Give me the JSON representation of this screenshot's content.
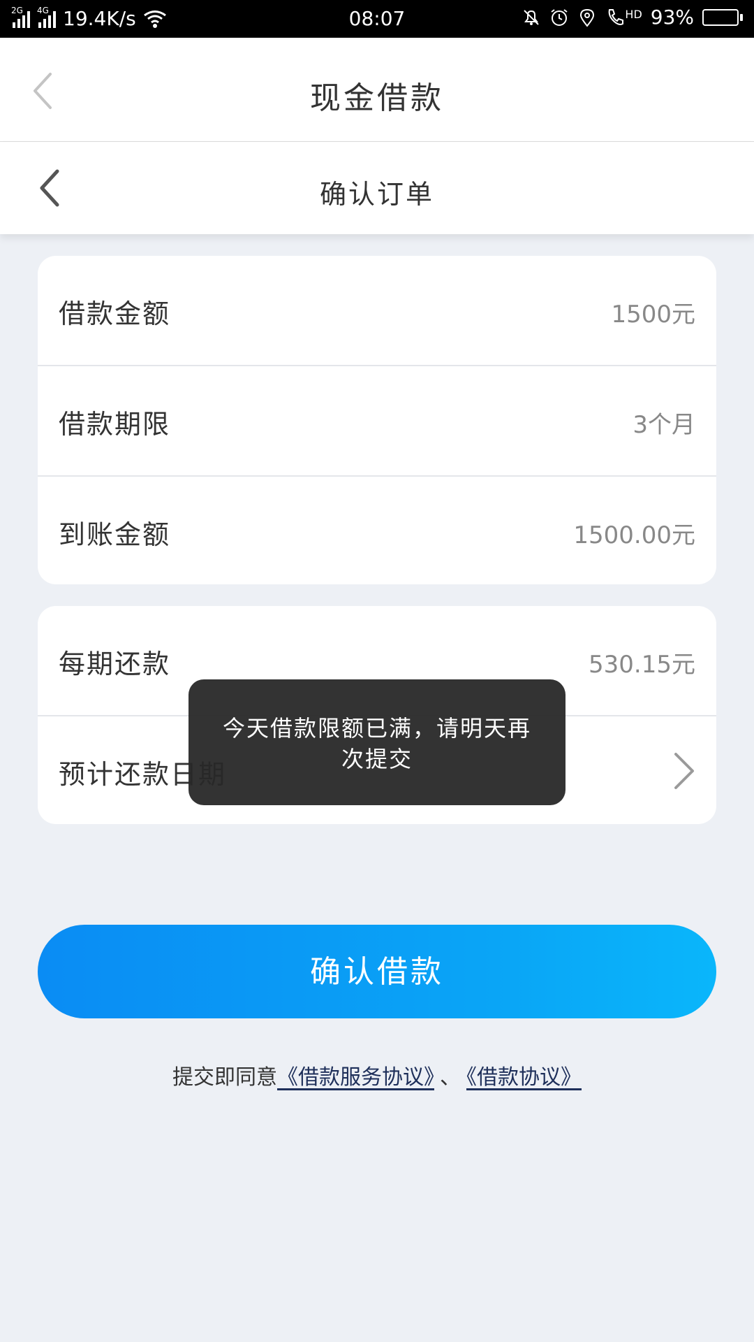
{
  "status_bar": {
    "network_1": "2G",
    "network_2": "4G",
    "speed": "19.4K/s",
    "time": "08:07",
    "battery": "93%",
    "battery_level": 0.93,
    "hd_label": "HD",
    "icons": [
      "signal-icon",
      "wifi-icon",
      "bell-mute-icon",
      "alarm-icon",
      "location-icon",
      "phone-hd-icon",
      "battery-icon"
    ]
  },
  "header": {
    "title": "现金借款"
  },
  "subheader": {
    "title": "确认订单"
  },
  "loan_card": {
    "rows": [
      {
        "label": "借款金额",
        "value": "1500元"
      },
      {
        "label": "借款期限",
        "value": "3个月"
      },
      {
        "label": "到账金额",
        "value": "1500.00元"
      }
    ]
  },
  "repay_card": {
    "rows": [
      {
        "label": "每期还款",
        "value": "530.15元"
      },
      {
        "label": "预计还款日期",
        "value": ""
      }
    ]
  },
  "toast": {
    "text": "今天借款限额已满，请明天再次提交"
  },
  "confirm_button": {
    "label": "确认借款"
  },
  "agreement": {
    "prefix": "提交即同意",
    "link1": "《借款服务协议》",
    "separator": "、",
    "link2": "《借款协议》"
  },
  "colors": {
    "accent": "#0a8cf4",
    "accent_end": "#0ab6fb",
    "background": "#edf0f5",
    "link": "#1e2f5a"
  }
}
